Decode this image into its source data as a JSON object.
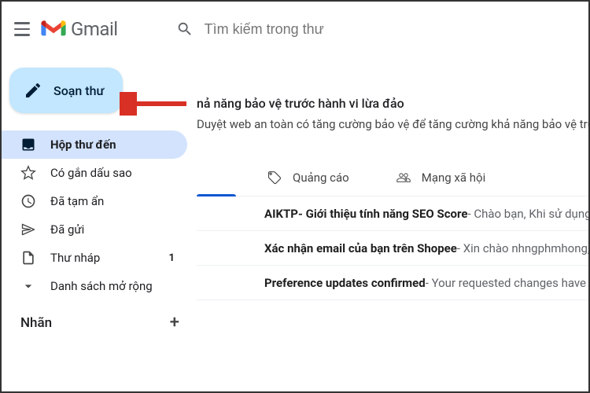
{
  "header": {
    "app_name": "Gmail",
    "search_placeholder": "Tìm kiếm trong thư"
  },
  "compose": {
    "label": "Soạn thư"
  },
  "nav": {
    "inbox": "Hộp thư đến",
    "starred": "Có gắn dấu sao",
    "snoozed": "Đã tạm ẩn",
    "sent": "Đã gửi",
    "drafts": "Thư nháp",
    "drafts_count": "1",
    "more": "Danh sách mở rộng"
  },
  "labels": {
    "heading": "Nhãn"
  },
  "banner": {
    "title": "nả năng bảo vệ trước hành vi lừa đảo",
    "subtitle": "Duyệt web an toàn có tăng cường bảo vệ để tăng cường khả năng bảo vệ trước các en"
  },
  "tabs": {
    "promotions": "Quảng cáo",
    "social": "Mạng xã hội"
  },
  "emails": [
    {
      "subject": "AIKTP- Giới thiệu tính năng SEO Score",
      "snippet": " - Chào bạn, Khi sử dụng AI viết b"
    },
    {
      "subject": "Xác nhận email của bạn trên Shopee",
      "snippet": " - Xin chào nhngphmhong, Vui lòng"
    },
    {
      "subject": "Preference updates confirmed",
      "snippet": " - Your requested changes have been ma"
    }
  ]
}
